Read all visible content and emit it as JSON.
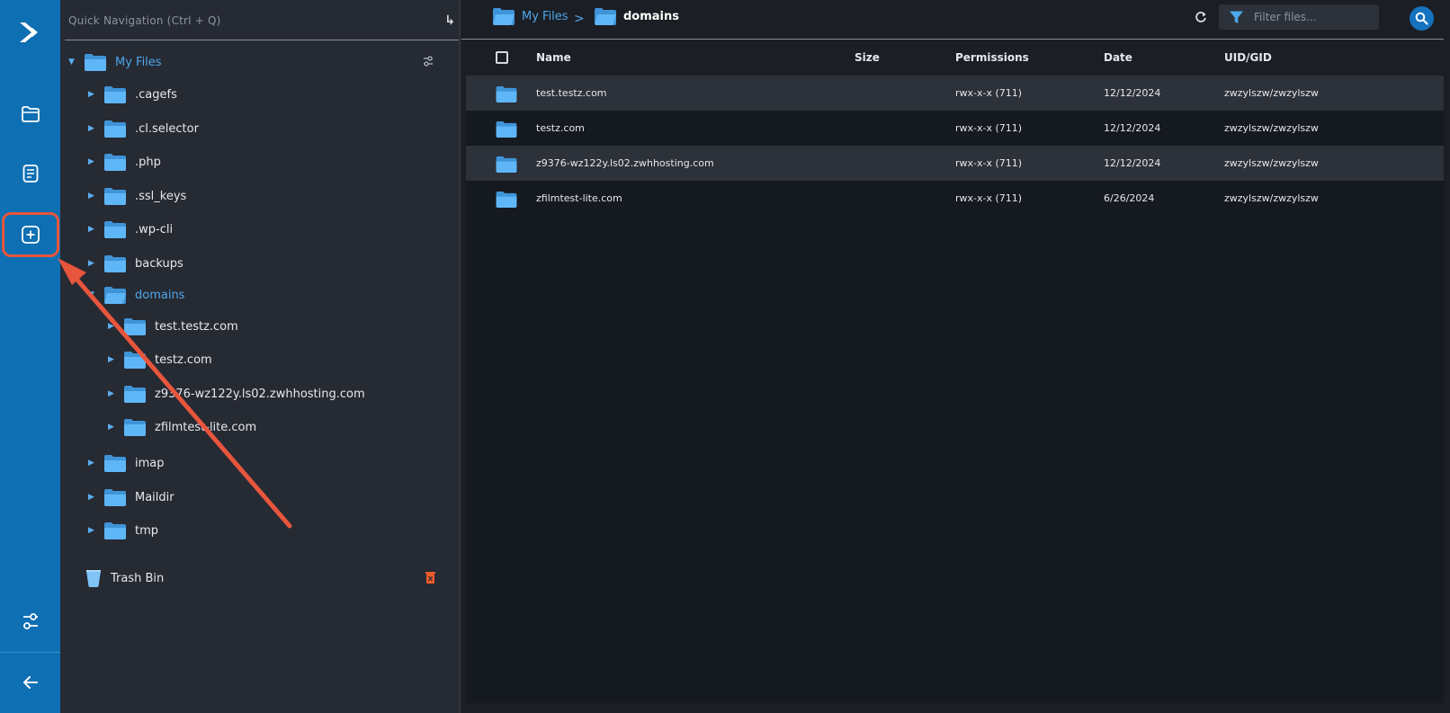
{
  "quick_nav": {
    "placeholder": "Quick Navigation (Ctrl + Q)",
    "go_glyph": "↳"
  },
  "tree": {
    "root": "My Files",
    "items": [
      {
        "label": ".cagefs"
      },
      {
        "label": ".cl.selector"
      },
      {
        "label": ".php"
      },
      {
        "label": ".ssl_keys"
      },
      {
        "label": ".wp-cli"
      },
      {
        "label": "backups"
      },
      {
        "label": "domains"
      },
      {
        "label": "test.testz.com"
      },
      {
        "label": "testz.com"
      },
      {
        "label": "z9376-wz122y.ls02.zwhhosting.com"
      },
      {
        "label": "zfilmtest-lite.com"
      },
      {
        "label": "imap"
      },
      {
        "label": "Maildir"
      },
      {
        "label": "tmp"
      }
    ],
    "trash": "Trash Bin"
  },
  "breadcrumb": {
    "root": "My Files",
    "sep": ">",
    "current": "domains"
  },
  "filter": {
    "placeholder": "Filter files..."
  },
  "table": {
    "headers": {
      "name": "Name",
      "size": "Size",
      "permissions": "Permissions",
      "date": "Date",
      "uid": "UID/GID"
    },
    "rows": [
      {
        "name": "test.testz.com",
        "size": "",
        "permissions": "rwx-x-x (711)",
        "date": "12/12/2024",
        "uid": "zwzylszw/zwzylszw"
      },
      {
        "name": "testz.com",
        "size": "",
        "permissions": "rwx-x-x (711)",
        "date": "12/12/2024",
        "uid": "zwzylszw/zwzylszw"
      },
      {
        "name": "z9376-wz122y.ls02.zwhhosting.com",
        "size": "",
        "permissions": "rwx-x-x (711)",
        "date": "12/12/2024",
        "uid": "zwzylszw/zwzylszw"
      },
      {
        "name": "zfilmtest-lite.com",
        "size": "",
        "permissions": "rwx-x-x (711)",
        "date": "6/26/2024",
        "uid": "zwzylszw/zwzylszw"
      }
    ]
  },
  "colors": {
    "rail": "#0f6fb3",
    "accent": "#4ea7ea",
    "folder": "#5fb6f6",
    "highlight": "#e8553d",
    "trash_delete": "#ef5a2b"
  },
  "icons": {
    "rail": [
      "logo-icon",
      "folder-icon",
      "document-icon",
      "add-box-icon",
      "settings-sliders-icon",
      "arrow-left-icon"
    ],
    "tree": [
      "caret-right-icon",
      "caret-down-icon",
      "folder-icon",
      "tune-icon",
      "trash-icon",
      "delete-icon"
    ],
    "toolbar": [
      "refresh-icon",
      "filter-icon",
      "search-icon"
    ]
  }
}
